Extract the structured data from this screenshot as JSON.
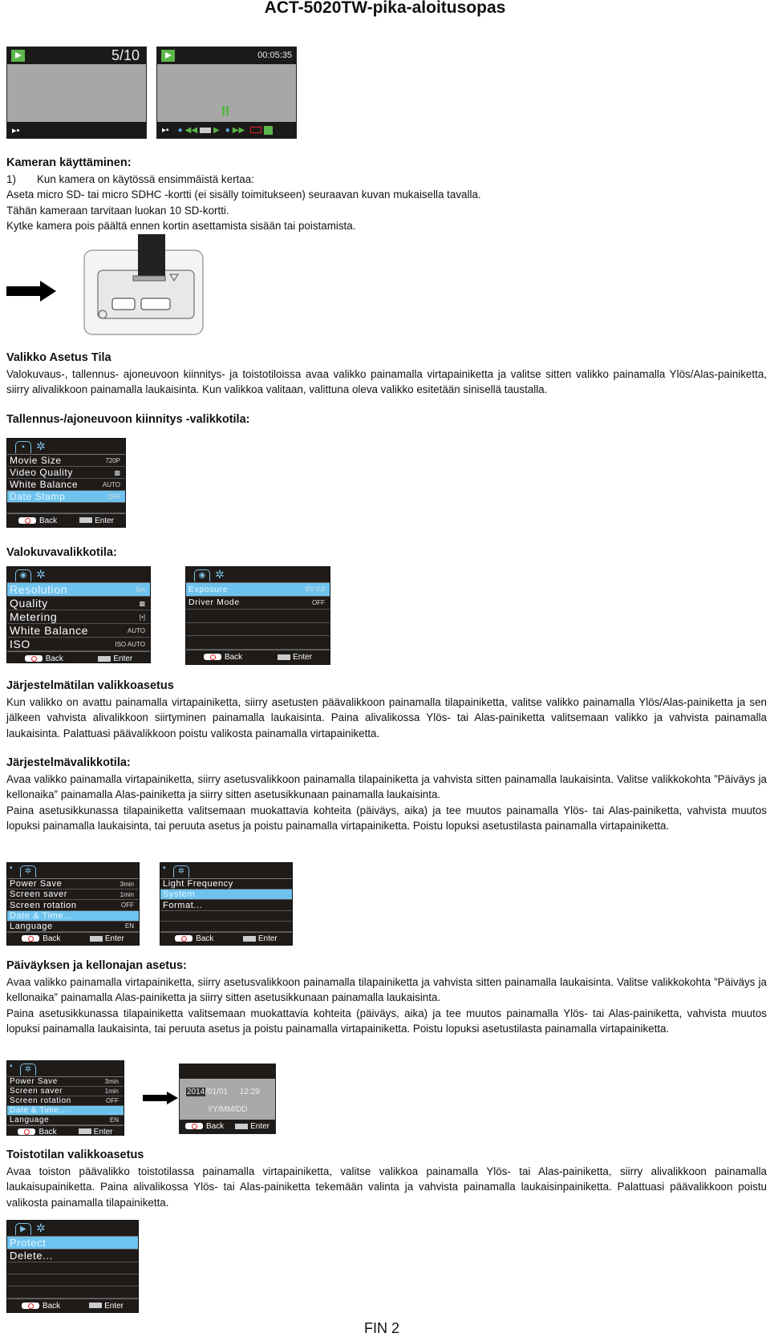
{
  "title": "ACT-5020TW-pika-aloitusopas",
  "playback_screens": [
    {
      "counter": "5/10",
      "icon": "play-icon",
      "mode_icon": "video-camera-icon"
    },
    {
      "counter": "00:05:35",
      "icon": "play-icon",
      "mode_icon": "video-camera-icon",
      "pause_icon": "pause-icon",
      "controls": [
        "up-icon",
        "rewind-icon",
        "ok-icon",
        "play-icon",
        "down-icon",
        "fast-forward-icon",
        "power-icon",
        "stop-icon"
      ]
    }
  ],
  "section1": {
    "heading": "Kameran käyttäminen:",
    "lines": [
      "1)       Kun kamera on käytössä ensimmäistä kertaa:",
      "Aseta micro SD- tai micro SDHC -kortti (ei sisälly toimitukseen) seuraavan kuvan mukaisella tavalla.",
      "Tähän kameraan tarvitaan luokan 10 SD-kortti.",
      "Kytke kamera pois päältä ennen kortin asettamista sisään tai poistamista."
    ]
  },
  "section2": {
    "heading": "Valikko Asetus Tila",
    "text": "Valokuvaus-, tallennus- ajoneuvoon kiinnitys- ja toistotiloissa avaa valikko painamalla virtapainiketta ja valitse sitten valikko painamalla Ylös/Alas-painiketta, siirry alivalikkoon painamalla laukaisinta. Kun valikkoa valitaan, valittuna oleva valikko esitetään sinisellä taustalla."
  },
  "section3": {
    "heading": "Tallennus-/ajoneuvoon kiinnitys -valikkotila:"
  },
  "section4": {
    "heading": "Valokuvavalikkotila:"
  },
  "section5": {
    "heading": "Järjestelmätilan valikkoasetus",
    "text": "Kun valikko on avattu painamalla virtapainiketta, siirry asetusten päävalikkoon painamalla tilapainiketta, valitse valikko painamalla Ylös/Alas-painiketta ja sen jälkeen vahvista alivalikkoon siirtyminen painamalla laukaisinta. Paina alivalikossa Ylös- tai Alas-painiketta valitsemaan valikko ja vahvista painamalla laukaisinta. Palattuasi päävalikkoon poistu valikosta painamalla virtapainiketta."
  },
  "section6": {
    "heading": "Järjestelmävalikkotila:",
    "text1": "Avaa valikko painamalla virtapainiketta, siirry asetusvalikkoon painamalla tilapainiketta ja vahvista sitten painamalla laukaisinta. Valitse valikkokohta ”Päiväys ja kellonaika” painamalla Alas-painiketta ja siirry sitten asetusikkunaan painamalla laukaisinta.",
    "text2": "Paina asetusikkunassa tilapainiketta valitsemaan muokattavia kohteita (päiväys, aika) ja tee muutos painamalla Ylös- tai Alas-painiketta, vahvista muutos lopuksi painamalla laukaisinta, tai peruuta asetus ja poistu painamalla virtapainiketta. Poistu lopuksi asetustilasta painamalla virtapainiketta."
  },
  "section7": {
    "heading": "Päiväyksen ja kellonajan asetus:",
    "text1": "Avaa valikko painamalla virtapainiketta, siirry asetusvalikkoon painamalla tilapainiketta ja vahvista sitten painamalla laukaisinta. Valitse valikkokohta ”Päiväys ja kellonaika” painamalla Alas-painiketta ja siirry sitten asetusikkunaan painamalla laukaisinta.",
    "text2": "Paina asetusikkunassa tilapainiketta valitsemaan muokattavia kohteita (päiväys, aika) ja tee muutos painamalla Ylös- tai Alas-painiketta, vahvista muutos lopuksi painamalla laukaisinta, tai peruuta asetus ja poistu painamalla virtapainiketta. Poistu lopuksi asetustilasta painamalla virtapainiketta."
  },
  "section8": {
    "heading": "Toistotilan valikkoasetus",
    "text": "Avaa toiston päävalikko toistotilassa painamalla virtapainiketta, valitse valikkoa painamalla Ylös- tai Alas-painiketta, siirry alivalikkoon painamalla laukaisupainiketta. Paina alivalikossa Ylös- tai Alas-painiketta tekemään valinta ja vahvista painamalla laukaisinpainiketta. Palattuasi päävalikkoon poistu valikosta painamalla tilapainiketta."
  },
  "menus": {
    "record": {
      "tab_icon": "video-camera-icon",
      "rows": [
        {
          "label": "Movie Size",
          "value": "720P"
        },
        {
          "label": "Video Quality",
          "value": "▩"
        },
        {
          "label": "White Balance",
          "value": "AUTO"
        },
        {
          "label": "Date Stamp",
          "value": "OFF",
          "selected": true
        },
        {
          "label": "",
          "value": ""
        }
      ],
      "back": "Back",
      "enter": "Enter"
    },
    "photo1": {
      "tab_icon": "photo-camera-icon",
      "rows": [
        {
          "label": "Resolution",
          "value": "5m",
          "selected": true
        },
        {
          "label": "Quality",
          "value": "▩"
        },
        {
          "label": "Metering",
          "value": "[•]"
        },
        {
          "label": "White Balance",
          "value": "AUTO"
        },
        {
          "label": "ISO",
          "value": "ISO AUTO"
        }
      ],
      "back": "Back",
      "enter": "Enter"
    },
    "photo2": {
      "tab_icon": "photo-camera-icon",
      "rows": [
        {
          "label": "Exposure",
          "value": "EV 0.0",
          "selected": true
        },
        {
          "label": "Driver Mode",
          "value": "OFF"
        },
        {
          "label": "",
          "value": ""
        },
        {
          "label": "",
          "value": ""
        },
        {
          "label": "",
          "value": ""
        }
      ],
      "back": "Back",
      "enter": "Enter"
    },
    "setup1": {
      "tab_icon": "gear-icon",
      "rows": [
        {
          "label": "Power  Save",
          "value": "3min"
        },
        {
          "label": "Screen saver",
          "value": "1min"
        },
        {
          "label": "Screen rotation",
          "value": "OFF"
        },
        {
          "label": "Date & Time...",
          "value": "",
          "selected": true
        },
        {
          "label": "Language",
          "value": "EN"
        }
      ],
      "back": "Back",
      "enter": "Enter"
    },
    "setup2": {
      "tab_icon": "gear-icon",
      "rows": [
        {
          "label": "Light Frequency",
          "value": ""
        },
        {
          "label": "System",
          "value": "",
          "selected": true
        },
        {
          "label": "Format...",
          "value": ""
        },
        {
          "label": "",
          "value": ""
        },
        {
          "label": "",
          "value": ""
        }
      ],
      "back": "Back",
      "enter": "Enter"
    },
    "setup3": {
      "tab_icon": "gear-icon",
      "rows": [
        {
          "label": "Power  Save",
          "value": "3min"
        },
        {
          "label": "Screen saver",
          "value": "1min"
        },
        {
          "label": "Screen rotation",
          "value": "OFF"
        },
        {
          "label": "Date & Time...",
          "value": "",
          "selected": true
        },
        {
          "label": "Language",
          "value": "EN"
        }
      ],
      "back": "Back",
      "enter": "Enter"
    },
    "playback": {
      "tab_icon": "play-icon",
      "rows": [
        {
          "label": "Protect",
          "value": "",
          "selected": true
        },
        {
          "label": "Delete...",
          "value": ""
        },
        {
          "label": "",
          "value": ""
        },
        {
          "label": "",
          "value": ""
        },
        {
          "label": "",
          "value": ""
        }
      ],
      "back": "Back",
      "enter": "Enter"
    }
  },
  "date_screen": {
    "year": "2014",
    "month_day": "/01/01",
    "time": "12:29",
    "format": "YY/MM/DD",
    "back": "Back",
    "enter": "Enter"
  },
  "colors": {
    "highlight": "#6ec3ee",
    "screen_bg": "#1e1b19",
    "play_green": "#5bb54a"
  },
  "footer": {
    "page": "FIN 2"
  }
}
